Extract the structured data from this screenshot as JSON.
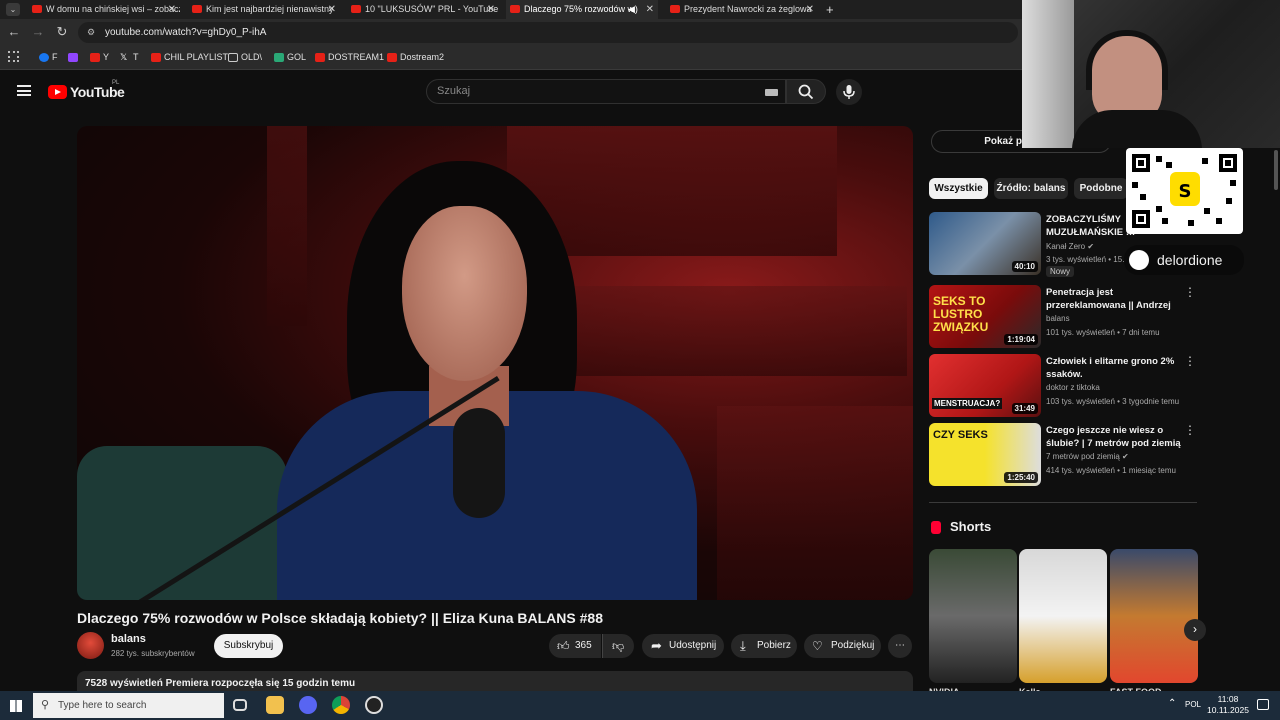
{
  "browser": {
    "tabs": [
      {
        "title": "W domu na chińskiej wsi – zobacz"
      },
      {
        "title": "Kim jest najbardziej nienawistny"
      },
      {
        "title": "10 \"LUKSUSÓW\" PRL - YouTube"
      },
      {
        "title": "Dlaczego 75% rozwodów w",
        "active": true
      },
      {
        "title": "Prezydent Nawrocki za żeglowa"
      }
    ],
    "new_tab": "+",
    "url": "youtube.com/watch?v=ghDy0_P-ihA",
    "bookmarks": [
      {
        "label": "F",
        "icon": "facebook-icon",
        "color": "#1877f2"
      },
      {
        "label": "",
        "icon": "twitch-icon",
        "color": "#9146ff"
      },
      {
        "label": "Y",
        "icon": "youtube-icon",
        "color": "#e62117"
      },
      {
        "label": "T",
        "icon": "x-icon",
        "color": "#ffffff"
      },
      {
        "label": "CHIL PLAYLIST",
        "icon": "youtube-icon",
        "color": "#e62117"
      },
      {
        "label": "OLD\\",
        "icon": "folder-icon",
        "color": "#cccccc"
      },
      {
        "label": "GOL",
        "icon": "gol-icon",
        "color": "#2aa876"
      },
      {
        "label": "DOSTREAM1",
        "icon": "youtube-icon",
        "color": "#e62117"
      },
      {
        "label": "Dostream2",
        "icon": "youtube-icon",
        "color": "#e62117"
      }
    ]
  },
  "youtube": {
    "logo_text": "YouTube",
    "logo_region": "PL",
    "search_placeholder": "Szukaj",
    "video": {
      "title": "Dlaczego 75% rozwodów w Polsce składają kobiety? || Eliza Kuna BALANS #88",
      "channel": "balans",
      "subscribers": "282 tys. subskrybentów",
      "subscribe_label": "Subskrybuj",
      "likes": "365",
      "share_label": "Udostępnij",
      "download_label": "Pobierz",
      "thanks_label": "Podziękuj",
      "more_label": "⋯",
      "views_line": "7528 wyświetleń  Premiera rozpoczęła się 15 godzin temu"
    },
    "show_chat_label": "Pokaż p",
    "chips": [
      "Wszystkie",
      "Źródło: balans",
      "Podobne"
    ],
    "recommendations": [
      {
        "title": "ZOBACZYLIŚMY MUZUŁMAŃSKIE …",
        "channel": "Kanał Zero ✔",
        "meta": "3 tys. wyświetleń • 15…",
        "duration": "40:10",
        "badge": "Nowy"
      },
      {
        "title": "Penetracja jest przereklamowana || Andrzej …",
        "channel": "balans",
        "meta": "101 tys. wyświetleń • 7 dni temu",
        "duration": "1:19:04"
      },
      {
        "title": "Człowiek i elitarne grono 2% ssaków.",
        "channel": "doktor z tiktoka",
        "meta": "103 tys. wyświetleń • 3 tygodnie temu",
        "duration": "31:49"
      },
      {
        "title": "Czego jeszcze nie wiesz o ślubie? | 7 metrów pod ziemią",
        "channel": "7 metrów pod ziemią ✔",
        "meta": "414 tys. wyświetleń • 1 miesiąc temu",
        "duration": "1:25:40"
      }
    ],
    "shorts_heading": "Shorts",
    "shorts": [
      {
        "title": "NVIDIA …"
      },
      {
        "title": "Kelle…"
      },
      {
        "title": "FAST FOOD…"
      }
    ]
  },
  "overlay": {
    "streamer": "delordione"
  },
  "taskbar": {
    "search_placeholder": "Type here to search",
    "language": "POL",
    "time": "11:08",
    "date": "10.11.2025"
  }
}
